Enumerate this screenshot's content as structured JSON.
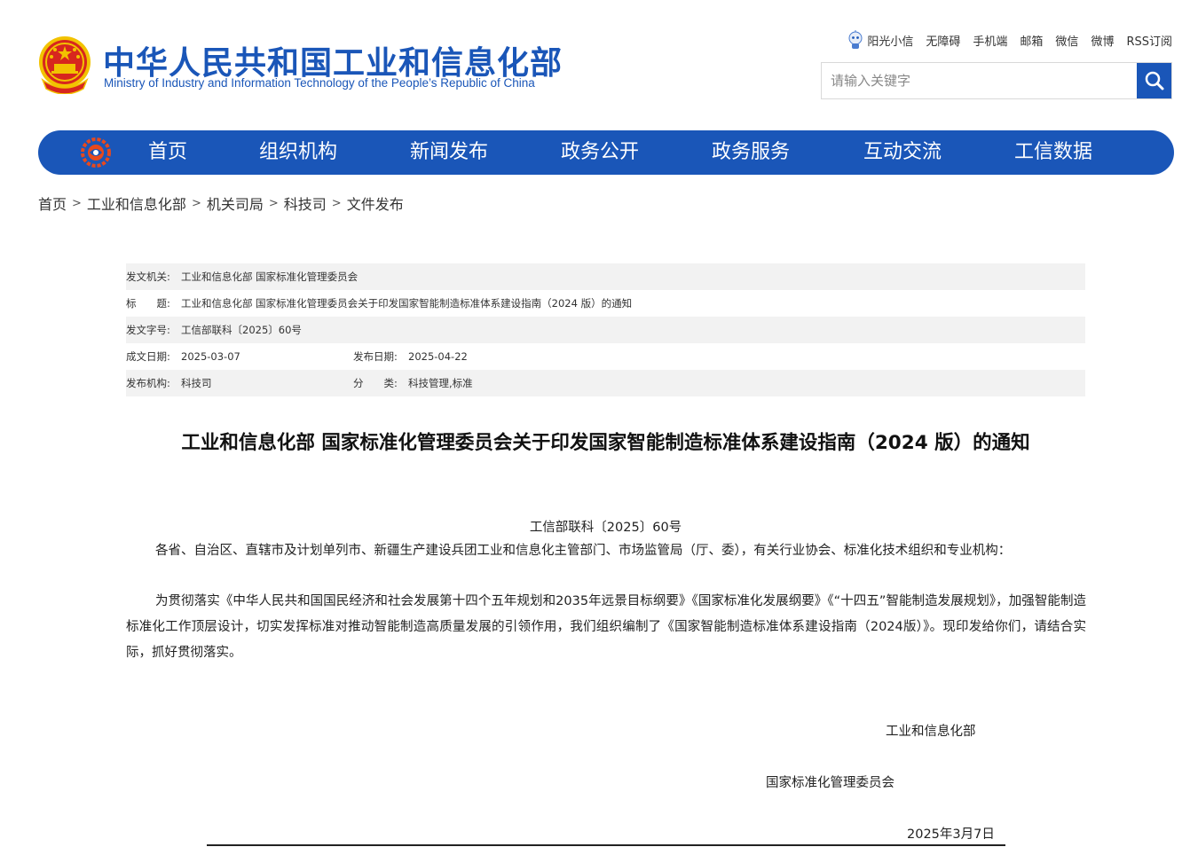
{
  "header": {
    "title_cn": "中华人民共和国工业和信息化部",
    "title_en": "Ministry of Industry and Information Technology of the People’s Republic of China",
    "links": [
      "阳光小信",
      "无障碍",
      "手机端",
      "邮箱",
      "微信",
      "微博",
      "RSS订阅"
    ],
    "search_placeholder": "请输入关键字"
  },
  "nav": {
    "items": [
      "首页",
      "组织机构",
      "新闻发布",
      "政务公开",
      "政务服务",
      "互动交流",
      "工信数据"
    ]
  },
  "breadcrumb": [
    "首页",
    "工业和信息化部",
    "机关司局",
    "科技司",
    "文件发布"
  ],
  "meta": {
    "issuer_label": "发文机关:",
    "issuer": "工业和信息化部 国家标准化管理委员会",
    "title_label": "标　　题:",
    "title": "工业和信息化部 国家标准化管理委员会关于印发国家智能制造标准体系建设指南（2024 版）的通知",
    "docno_label": "发文字号:",
    "docno": "工信部联科〔2025〕60号",
    "created_label": "成文日期:",
    "created": "2025-03-07",
    "published_label": "发布日期:",
    "published": "2025-04-22",
    "org_label": "发布机构:",
    "org": "科技司",
    "category_label": "分　　类:",
    "category": "科技管理,标准"
  },
  "article": {
    "title": "工业和信息化部 国家标准化管理委员会关于印发国家智能制造标准体系建设指南（2024 版）的通知",
    "doc_number": "工信部联科〔2025〕60号",
    "para1": "各省、自治区、直辖市及计划单列市、新疆生产建设兵团工业和信息化主管部门、市场监管局（厅、委），有关行业协会、标准化技术组织和专业机构：",
    "para2": "为贯彻落实《中华人民共和国国民经济和社会发展第十四个五年规划和2035年远景目标纲要》《国家标准化发展纲要》《“十四五”智能制造发展规划》，加强智能制造标准化工作顶层设计，切实发挥标准对推动智能制造高质量发展的引领作用，我们组织编制了《国家智能制造标准体系建设指南（2024版）》。现印发给你们，请结合实际，抓好贯彻落实。",
    "sign1": "工业和信息化部",
    "sign2": "国家标准化管理委员会",
    "date": "2025年3月7日"
  },
  "colors": {
    "brand_blue": "#1a56b8",
    "emblem_red": "#d7261e",
    "emblem_gold": "#f2c200"
  },
  "icons": [
    "national-emblem-icon",
    "robot-mascot-icon",
    "search-icon",
    "nav-logo-icon"
  ]
}
